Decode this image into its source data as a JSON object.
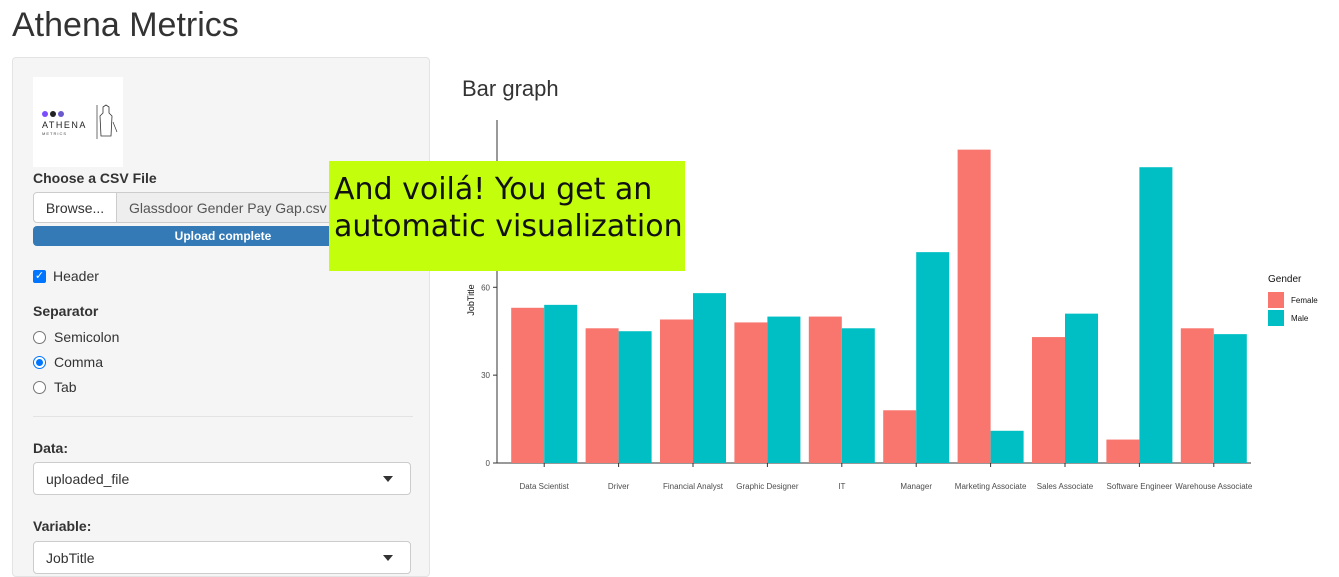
{
  "app": {
    "title": "Athena Metrics"
  },
  "sidebar": {
    "logo": {
      "brand": "ATHENA",
      "sub": "METRICS"
    },
    "file_label": "Choose a CSV File",
    "browse_label": "Browse...",
    "file_name": "Glassdoor Gender Pay Gap.csv",
    "upload_status": "Upload complete",
    "header_label": "Header",
    "header_checked": true,
    "separator_label": "Separator",
    "separator_options": [
      "Semicolon",
      "Comma",
      "Tab"
    ],
    "separator_selected": "Comma",
    "data_label": "Data:",
    "data_value": "uploaded_file",
    "variable_label": "Variable:",
    "variable_value": "JobTitle"
  },
  "overlay": {
    "text": "And voilá! You get an automatic visualization"
  },
  "main": {
    "chart_title": "Bar graph"
  },
  "chart_data": {
    "type": "bar",
    "ylabel": "JobTitle",
    "categories": [
      "Data Scientist",
      "Driver",
      "Financial Analyst",
      "Graphic Designer",
      "IT",
      "Manager",
      "Marketing Associate",
      "Sales Associate",
      "Software Engineer",
      "Warehouse Associate"
    ],
    "series": [
      {
        "name": "Female",
        "color": "#f8766d",
        "values": [
          53,
          46,
          49,
          48,
          50,
          18,
          107,
          43,
          8,
          46
        ]
      },
      {
        "name": "Male",
        "color": "#00bfc4",
        "values": [
          54,
          45,
          58,
          50,
          46,
          72,
          11,
          51,
          101,
          44
        ]
      }
    ],
    "yticks": [
      0,
      30,
      60
    ],
    "ylim": [
      0,
      112
    ],
    "legend_title": "Gender",
    "legend_position": "right"
  }
}
